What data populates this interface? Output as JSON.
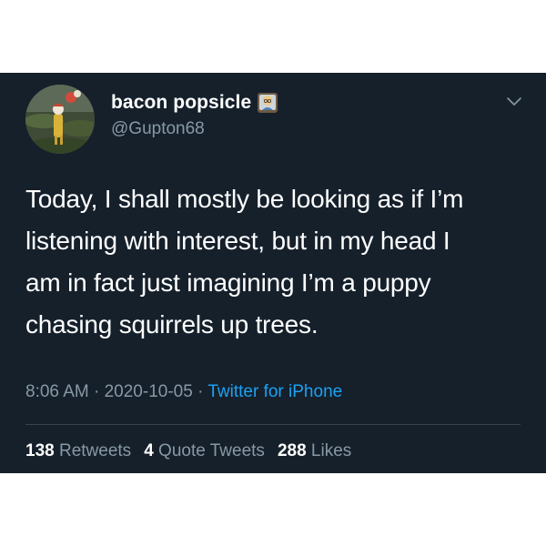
{
  "user": {
    "display_name": "bacon popsicle",
    "handle": "@Gupton68",
    "name_emoji": "teacher-emoji-icon"
  },
  "tweet": {
    "text": "Today, I shall mostly be looking as if I’m\nlistening with interest, but in my head I\nam in fact just imagining I’m a puppy\nchasing squirrels up trees."
  },
  "meta": {
    "time": "8:06 AM",
    "separator1": " · ",
    "date": "2020-10-05",
    "separator2": " · ",
    "source": "Twitter for iPhone"
  },
  "stats": {
    "retweets_count": "138",
    "retweets_label": "Retweets",
    "quotes_count": "4",
    "quotes_label": "Quote Tweets",
    "likes_count": "288",
    "likes_label": "Likes"
  },
  "colors": {
    "background": "#15202b",
    "text_primary": "#ffffff",
    "text_secondary": "#8899a6",
    "link": "#1da1f2",
    "divider": "#38444d"
  }
}
